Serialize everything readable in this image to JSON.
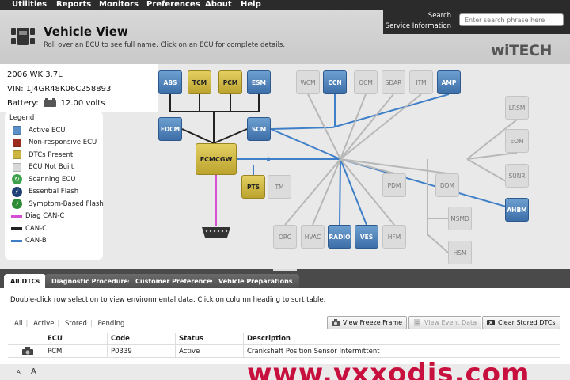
{
  "menu": [
    "Utilities",
    "Reports",
    "Monitors",
    "Preferences",
    "About",
    "Help"
  ],
  "header": {
    "title": "Vehicle View",
    "subtitle": "Roll over an ECU to see full name. Click on an ECU for complete details.",
    "search_label": "Search",
    "service_label": "Service Information",
    "search_placeholder": "Enter search phrase here",
    "brand": "wiTECH"
  },
  "vehicle": {
    "model": "2006 WK 3.7L",
    "vin": "VIN: 1J4GR48K06C258893",
    "battery_label": "Battery:",
    "battery_value": "12.00 volts"
  },
  "legend": {
    "title": "Legend",
    "items": [
      {
        "label": "Active ECU",
        "kind": "swatch",
        "color": "#5b8fc7"
      },
      {
        "label": "Non-responsive ECU",
        "kind": "swatch",
        "color": "#9b2d1e"
      },
      {
        "label": "DTCs Present",
        "kind": "swatch",
        "color": "#cdb63f"
      },
      {
        "label": "ECU Not Built",
        "kind": "swatch",
        "color": "#d9d9d9"
      },
      {
        "label": "Scanning ECU",
        "kind": "glyph",
        "color": "#3fa34d",
        "icon": "refresh-icon"
      },
      {
        "label": "Essential Flash",
        "kind": "glyph",
        "color": "#1d3f73",
        "icon": "flash-icon"
      },
      {
        "label": "Symptom-Based Flash",
        "kind": "glyph",
        "color": "#2e8b35",
        "icon": "flash-icon"
      },
      {
        "label": "Diag CAN-C",
        "kind": "line",
        "color": "#d44fd4"
      },
      {
        "label": "CAN-C",
        "kind": "line",
        "color": "#222222"
      },
      {
        "label": "CAN-B",
        "kind": "line",
        "color": "#3f7fc8"
      }
    ]
  },
  "ecus": [
    {
      "id": "ABS",
      "label": "ABS",
      "state": "blue"
    },
    {
      "id": "TCM",
      "label": "TCM",
      "state": "yellow"
    },
    {
      "id": "PCM",
      "label": "PCM",
      "state": "yellow"
    },
    {
      "id": "ESM",
      "label": "ESM",
      "state": "blue"
    },
    {
      "id": "FDCM",
      "label": "FDCM",
      "state": "blue"
    },
    {
      "id": "SCM",
      "label": "SCM",
      "state": "blue"
    },
    {
      "id": "FCMCGW",
      "label": "FCMCGW",
      "state": "yellow"
    },
    {
      "id": "PTS",
      "label": "PTS",
      "state": "yellow"
    },
    {
      "id": "TM",
      "label": "TM",
      "state": "gray"
    },
    {
      "id": "WCM",
      "label": "WCM",
      "state": "gray"
    },
    {
      "id": "CCN",
      "label": "CCN",
      "state": "blue"
    },
    {
      "id": "OCM",
      "label": "OCM",
      "state": "gray"
    },
    {
      "id": "SDAR",
      "label": "SDAR",
      "state": "gray"
    },
    {
      "id": "ITM",
      "label": "ITM",
      "state": "gray"
    },
    {
      "id": "AMP",
      "label": "AMP",
      "state": "blue"
    },
    {
      "id": "LRSM",
      "label": "LRSM",
      "state": "gray"
    },
    {
      "id": "EOM",
      "label": "EOM",
      "state": "gray"
    },
    {
      "id": "SUNR",
      "label": "SUNR",
      "state": "gray"
    },
    {
      "id": "AHBM",
      "label": "AHBM",
      "state": "blue"
    },
    {
      "id": "PDM",
      "label": "PDM",
      "state": "gray"
    },
    {
      "id": "DDM",
      "label": "DDM",
      "state": "gray"
    },
    {
      "id": "MSMD",
      "label": "MSMD",
      "state": "gray"
    },
    {
      "id": "HSM",
      "label": "HSM",
      "state": "gray"
    },
    {
      "id": "ORC",
      "label": "ORC",
      "state": "gray"
    },
    {
      "id": "HVAC",
      "label": "HVAC",
      "state": "gray"
    },
    {
      "id": "RADIO",
      "label": "RADIO",
      "state": "blue"
    },
    {
      "id": "VES",
      "label": "VES",
      "state": "blue"
    },
    {
      "id": "HFM",
      "label": "HFM",
      "state": "gray"
    }
  ],
  "tabs": [
    "All DTCs",
    "Diagnostic Procedures",
    "Customer Preferences",
    "Vehicle Preparations"
  ],
  "panel": {
    "instructions": "Double-click row selection to view environmental data.  Click on column heading to sort table.",
    "filters": [
      "All",
      "Active",
      "Stored",
      "Pending"
    ],
    "buttons": {
      "freeze": "View Freeze Frame",
      "event": "View Event Data",
      "clear": "Clear Stored DTCs"
    }
  },
  "table": {
    "headers": [
      "",
      "ECU",
      "Code",
      "Status",
      "Description"
    ],
    "rows": [
      {
        "ecu": "PCM",
        "code": "P0339",
        "status": "Active",
        "description": "Crankshaft Position Sensor Intermittent"
      }
    ]
  },
  "font_controls": [
    "A",
    "A"
  ],
  "watermark": "www.vxxodis.com"
}
